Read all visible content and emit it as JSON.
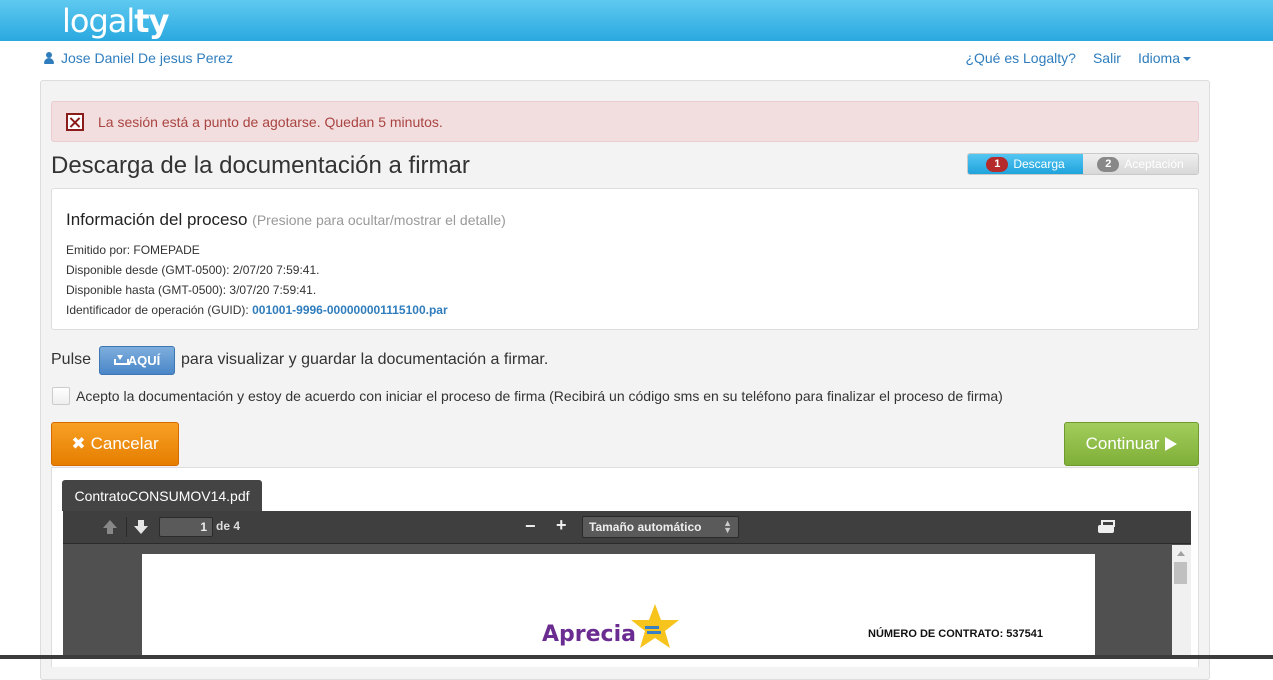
{
  "brand": {
    "logo_text_light": "logal",
    "logo_text_bold": "ty"
  },
  "user_bar": {
    "user_name": "Jose Daniel De jesus Perez",
    "links": {
      "what_is": "¿Qué es Logalty?",
      "exit": "Salir",
      "language": "Idioma"
    }
  },
  "alert": {
    "text": "La sesión está a punto de agotarse. Quedan 5 minutos."
  },
  "page": {
    "title": "Descarga de la documentación a firmar"
  },
  "steps": [
    {
      "num": "1",
      "label": "Descarga",
      "active": true
    },
    {
      "num": "2",
      "label": "Aceptación",
      "active": false
    }
  ],
  "process_info": {
    "title": "Información del proceso",
    "hint": "(Presione para ocultar/mostrar el detalle)",
    "emitted_by": "Emitido por: FOMEPADE",
    "available_from": "Disponible desde (GMT-0500): 2/07/20 7:59:41.",
    "available_until": "Disponible hasta (GMT-0500): 3/07/20 7:59:41.",
    "guid_label": "Identificador de operación (GUID):",
    "guid_value": "001001-9996-000000001115100.par"
  },
  "download": {
    "prefix": "Pulse",
    "button_label": "AQUÍ",
    "suffix": "para visualizar y guardar la documentación a firmar."
  },
  "accept": {
    "label": "Acepto la documentación y estoy de acuerdo con iniciar el proceso de firma (Recibirá un código sms en su teléfono para finalizar el proceso de firma)",
    "checked": false
  },
  "actions": {
    "cancel_label": "Cancelar",
    "continue_label": "Continuar"
  },
  "document": {
    "tab_label": "ContratoCONSUMOV14.pdf",
    "current_page": "1",
    "total_pages": "de 4",
    "zoom": "Tamaño automático",
    "pdf_brand": "Aprecia",
    "contract_number": "NÚMERO DE CONTRATO: 537541"
  },
  "colors": {
    "accent": "#2aa9e0",
    "alert_bg": "#f2dede",
    "cancel": "#f0920f",
    "continue": "#8dbd45",
    "pdf_brand": "#6b2c91"
  }
}
